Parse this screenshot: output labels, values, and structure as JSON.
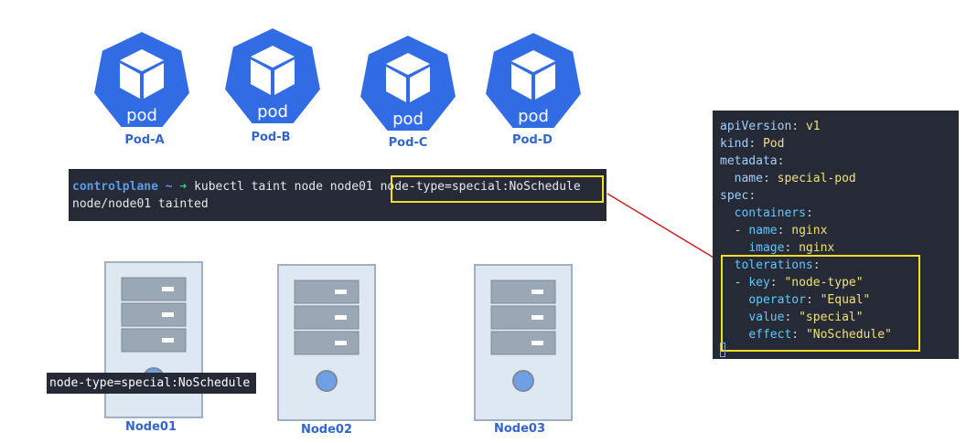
{
  "pods": [
    {
      "glyph": "pod",
      "label": "Pod-A"
    },
    {
      "glyph": "pod",
      "label": "Pod-B"
    },
    {
      "glyph": "pod",
      "label": "Pod-C"
    },
    {
      "glyph": "pod",
      "label": "Pod-D"
    }
  ],
  "terminal": {
    "prompt_host": "controlplane ~",
    "prompt_arrow": "➜",
    "command": "kubectl taint node node01",
    "taint": "node-type=special:NoSchedule",
    "output": "node/node01 tainted"
  },
  "nodes": [
    {
      "label": "Node01",
      "taint_tag": "node-type=special:NoSchedule"
    },
    {
      "label": "Node02"
    },
    {
      "label": "Node03"
    }
  ],
  "yaml": {
    "l1k": "apiVersion",
    "l1v": "v1",
    "l2k": "kind",
    "l2v": "Pod",
    "l3k": "metadata",
    "l4k": "name",
    "l4v": "special-pod",
    "l5k": "spec",
    "l6k": "containers",
    "l7k": "name",
    "l7v": "nginx",
    "l8k": "image",
    "l8v": "nginx",
    "l9k": "tolerations",
    "l10k": "key",
    "l10v": "\"node-type\"",
    "l11k": "operator",
    "l11v": "\"Equal\"",
    "l12k": "value",
    "l12v": "\"special\"",
    "l13k": "effect",
    "l13v": "\"NoSchedule\""
  },
  "colors": {
    "kube_blue": "#326ce5",
    "highlight": "#f2e020",
    "connector": "#cc2222",
    "terminal_bg": "#252a36"
  }
}
